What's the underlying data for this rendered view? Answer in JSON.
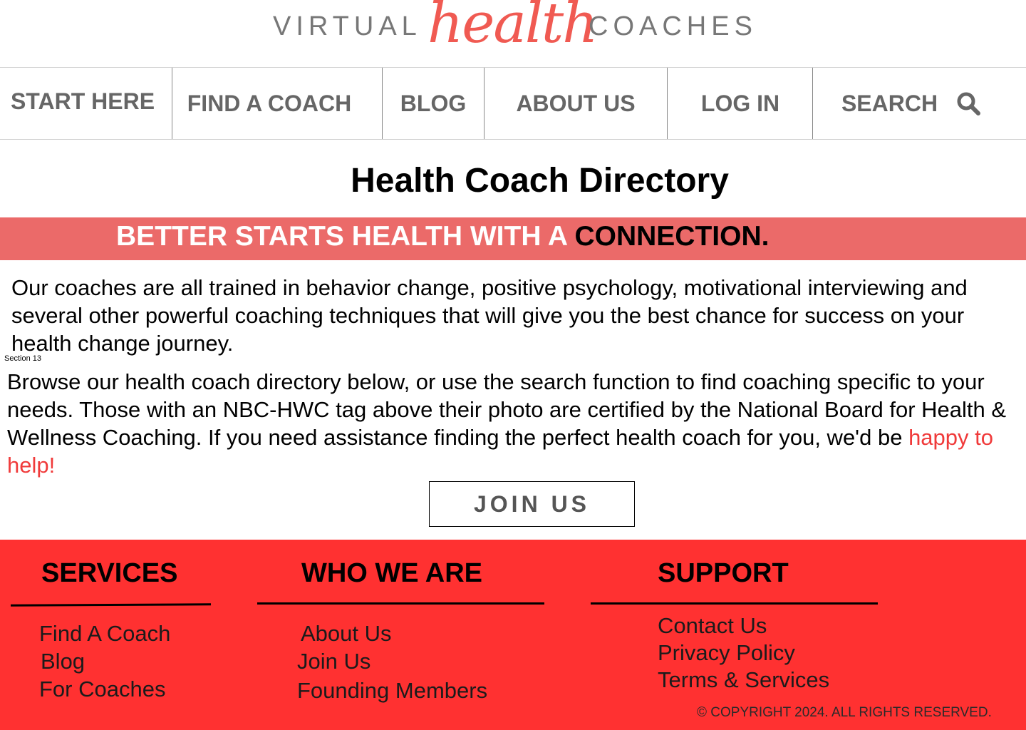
{
  "logo": {
    "virtual": "VIRTUAL",
    "health": "health",
    "coaches": "COACHES"
  },
  "nav": {
    "start_here": "START HERE",
    "find_coach": "FIND  A COACH",
    "blog": "BLOG",
    "about_us": "ABOUT US",
    "log_in": "LOG IN",
    "search": "SEARCH"
  },
  "page": {
    "title": "Health Coach Directory",
    "banner_light": "BETTER STARTS HEALTH WITH A ",
    "banner_dark": "CONNECTION.",
    "intro": "Our coaches are all trained in behavior change, positive psychology, motivational interviewing and several other powerful coaching techniques that will give you the best chance for success on your health change journey.",
    "section_label": "Section 13",
    "browse_text": "Browse our health coach directory below, or use the search function to find coaching specific to your needs. Those with an NBC-HWC tag above their photo are certified by the National Board for Health & Wellness Coaching. If you need assistance finding the perfect health coach for you, we'd be ",
    "browse_link": "happy to help!",
    "join_button": "JOIN US"
  },
  "footer": {
    "services": {
      "heading": "SERVICES",
      "links": [
        "Find A Coach",
        "Blog",
        "For Coaches"
      ]
    },
    "who_we_are": {
      "heading": "WHO WE ARE",
      "links": [
        "About Us",
        "Join Us",
        "Founding Members"
      ]
    },
    "support": {
      "heading": "SUPPORT",
      "links": [
        "Contact Us",
        "Privacy Policy",
        "Terms & Services"
      ]
    },
    "copyright": "© COPYRIGHT 2024. ALL RIGHTS RESERVED."
  },
  "colors": {
    "brand_red": "#ff3131",
    "banner": "#eb6a69",
    "logo_accent": "#f05a52",
    "link_red": "#f03a3a"
  }
}
